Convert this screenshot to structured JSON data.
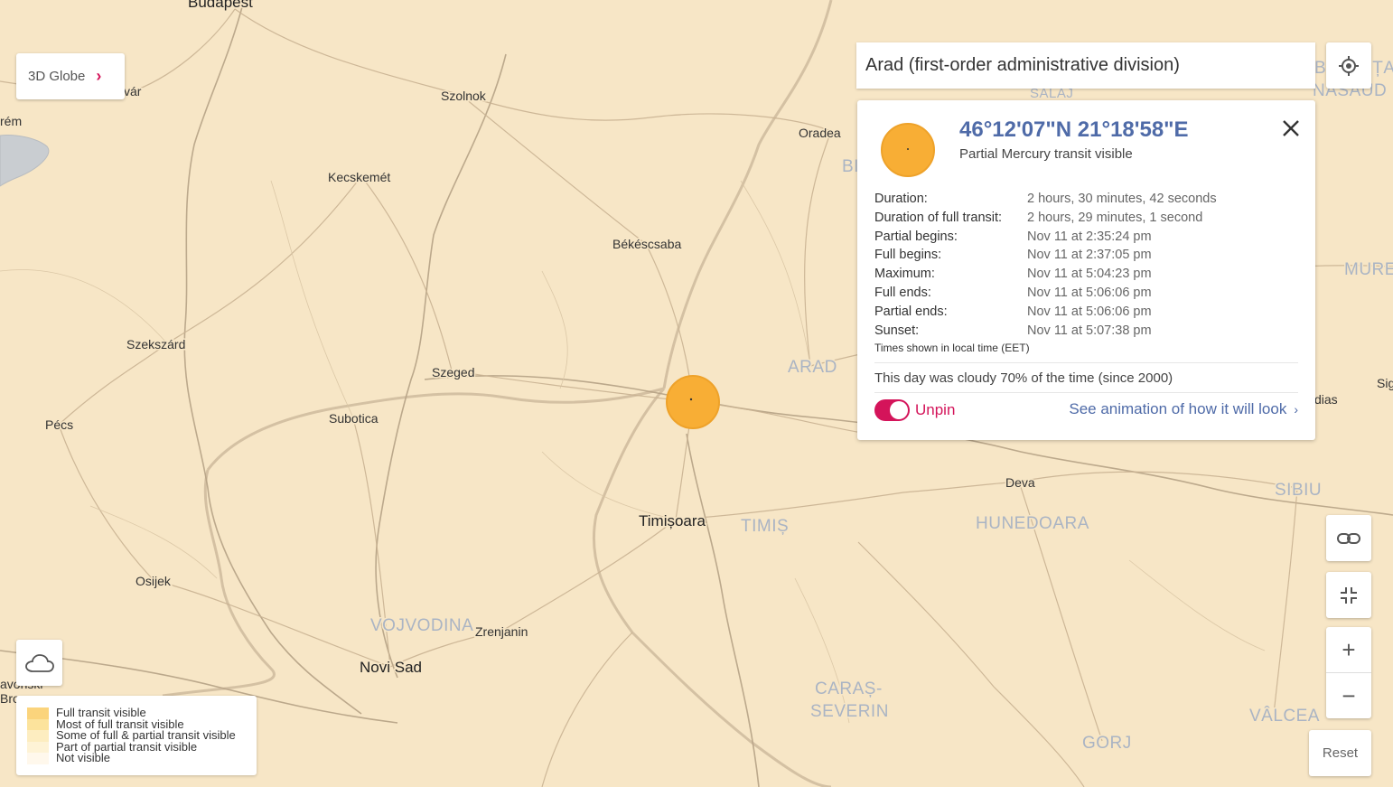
{
  "globe_button": {
    "label": "3D Globe"
  },
  "search": {
    "value": "Arad (first-order administrative division)"
  },
  "popup": {
    "coords": "46°12'07\"N 21°18'58\"E",
    "subtitle": "Partial Mercury transit visible",
    "rows": [
      {
        "k": "Duration:",
        "v": "2 hours, 30 minutes, 42 seconds"
      },
      {
        "k": "Duration of full transit:",
        "v": "2 hours, 29 minutes, 1 second"
      },
      {
        "k": "Partial begins:",
        "v": "Nov 11 at 2:35:24 pm"
      },
      {
        "k": "Full begins:",
        "v": "Nov 11 at 2:37:05 pm"
      },
      {
        "k": "Maximum:",
        "v": "Nov 11 at 5:04:23 pm"
      },
      {
        "k": "Full ends:",
        "v": "Nov 11 at 5:06:06 pm"
      },
      {
        "k": "Partial ends:",
        "v": "Nov 11 at 5:06:06 pm"
      },
      {
        "k": "Sunset:",
        "v": "Nov 11 at 5:07:38 pm"
      }
    ],
    "note": "Times shown in local time (EET)",
    "cloudy": "This day was cloudy 70% of the time (since 2000)",
    "unpin": "Unpin",
    "animation_link": "See animation of how it will look",
    "sun_color": "#f8ae35"
  },
  "controls": {
    "reset": "Reset",
    "zoom_in": "+",
    "zoom_out": "−"
  },
  "legend": [
    {
      "label": "Full transit visible",
      "color": "#fbd47c"
    },
    {
      "label": "Most of full transit visible",
      "color": "#fce39c"
    },
    {
      "label": "Some of full & partial transit visible",
      "color": "#fdedc0"
    },
    {
      "label": "Part of partial transit visible",
      "color": "#fef3d6"
    },
    {
      "label": "Not visible",
      "color": "#fff8ec"
    }
  ],
  "map": {
    "cities": {
      "budapest": "Budapest",
      "szolnok": "Szolnok",
      "kecskemet": "Kecskemét",
      "oradea": "Oradea",
      "bekescsaba": "Békéscsaba",
      "szekszard": "Szekszárd",
      "szeged": "Szeged",
      "subotica": "Subotica",
      "pecs": "Pécs",
      "timisoara": "Timișoara",
      "deva": "Deva",
      "osijek": "Osijek",
      "zrenjanin": "Zrenjanin",
      "novisad": "Novi Sad",
      "var": "vár",
      "erem": "rém",
      "dias": "dias",
      "sig": "Sig",
      "avonski": "avonski",
      "bro": "Bro"
    },
    "regions": {
      "arad": "ARAD",
      "timis": "TIMIȘ",
      "hunedoara": "HUNEDOARA",
      "sibiu": "SIBIU",
      "vojvodina": "VOJVODINA",
      "caras1": "CARAȘ-",
      "caras2": "SEVERIN",
      "valcea": "VÂLCEA",
      "gorj": "GORJ",
      "salaj": "SALAJ",
      "bi": "BI",
      "mures": "MUREȘ",
      "bistrita1": "BISTRIȚA-",
      "bistrita2": "NĂSĂUD"
    }
  },
  "icons": [
    "chevron-right-icon",
    "locate-icon",
    "close-icon",
    "link-icon",
    "collapse-icon",
    "cloud-icon"
  ]
}
